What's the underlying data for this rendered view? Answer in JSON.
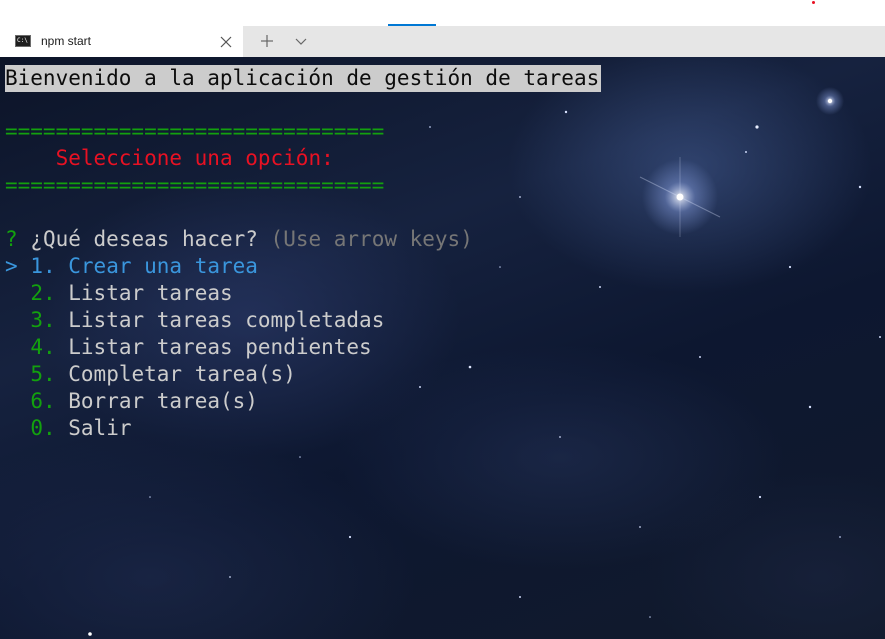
{
  "tab": {
    "title": "npm start",
    "icon": "console-icon",
    "icon_glyph": "C:\\"
  },
  "terminal": {
    "welcome": "Bienvenido a la aplicación de gestión de tareas",
    "rule": "==============================",
    "heading": "Seleccione una opción:",
    "prompt": {
      "qmark": "?",
      "question": "¿Qué deseas hacer?",
      "hint": "(Use arrow keys)"
    },
    "pointer": ">",
    "menu": [
      {
        "number": "1.",
        "label": "Crear una tarea",
        "selected": true
      },
      {
        "number": "2.",
        "label": "Listar tareas",
        "selected": false
      },
      {
        "number": "3.",
        "label": "Listar tareas completadas",
        "selected": false
      },
      {
        "number": "4.",
        "label": "Listar tareas pendientes",
        "selected": false
      },
      {
        "number": "5.",
        "label": "Completar tarea(s)",
        "selected": false
      },
      {
        "number": "6.",
        "label": "Borrar tarea(s)",
        "selected": false
      },
      {
        "number": "0.",
        "label": "Salir",
        "selected": false
      }
    ]
  },
  "colors": {
    "green": "#13a10e",
    "red": "#e81123",
    "blue": "#3a96dd",
    "text": "#cccccc",
    "hint": "#767676",
    "accent": "#0078d4"
  }
}
